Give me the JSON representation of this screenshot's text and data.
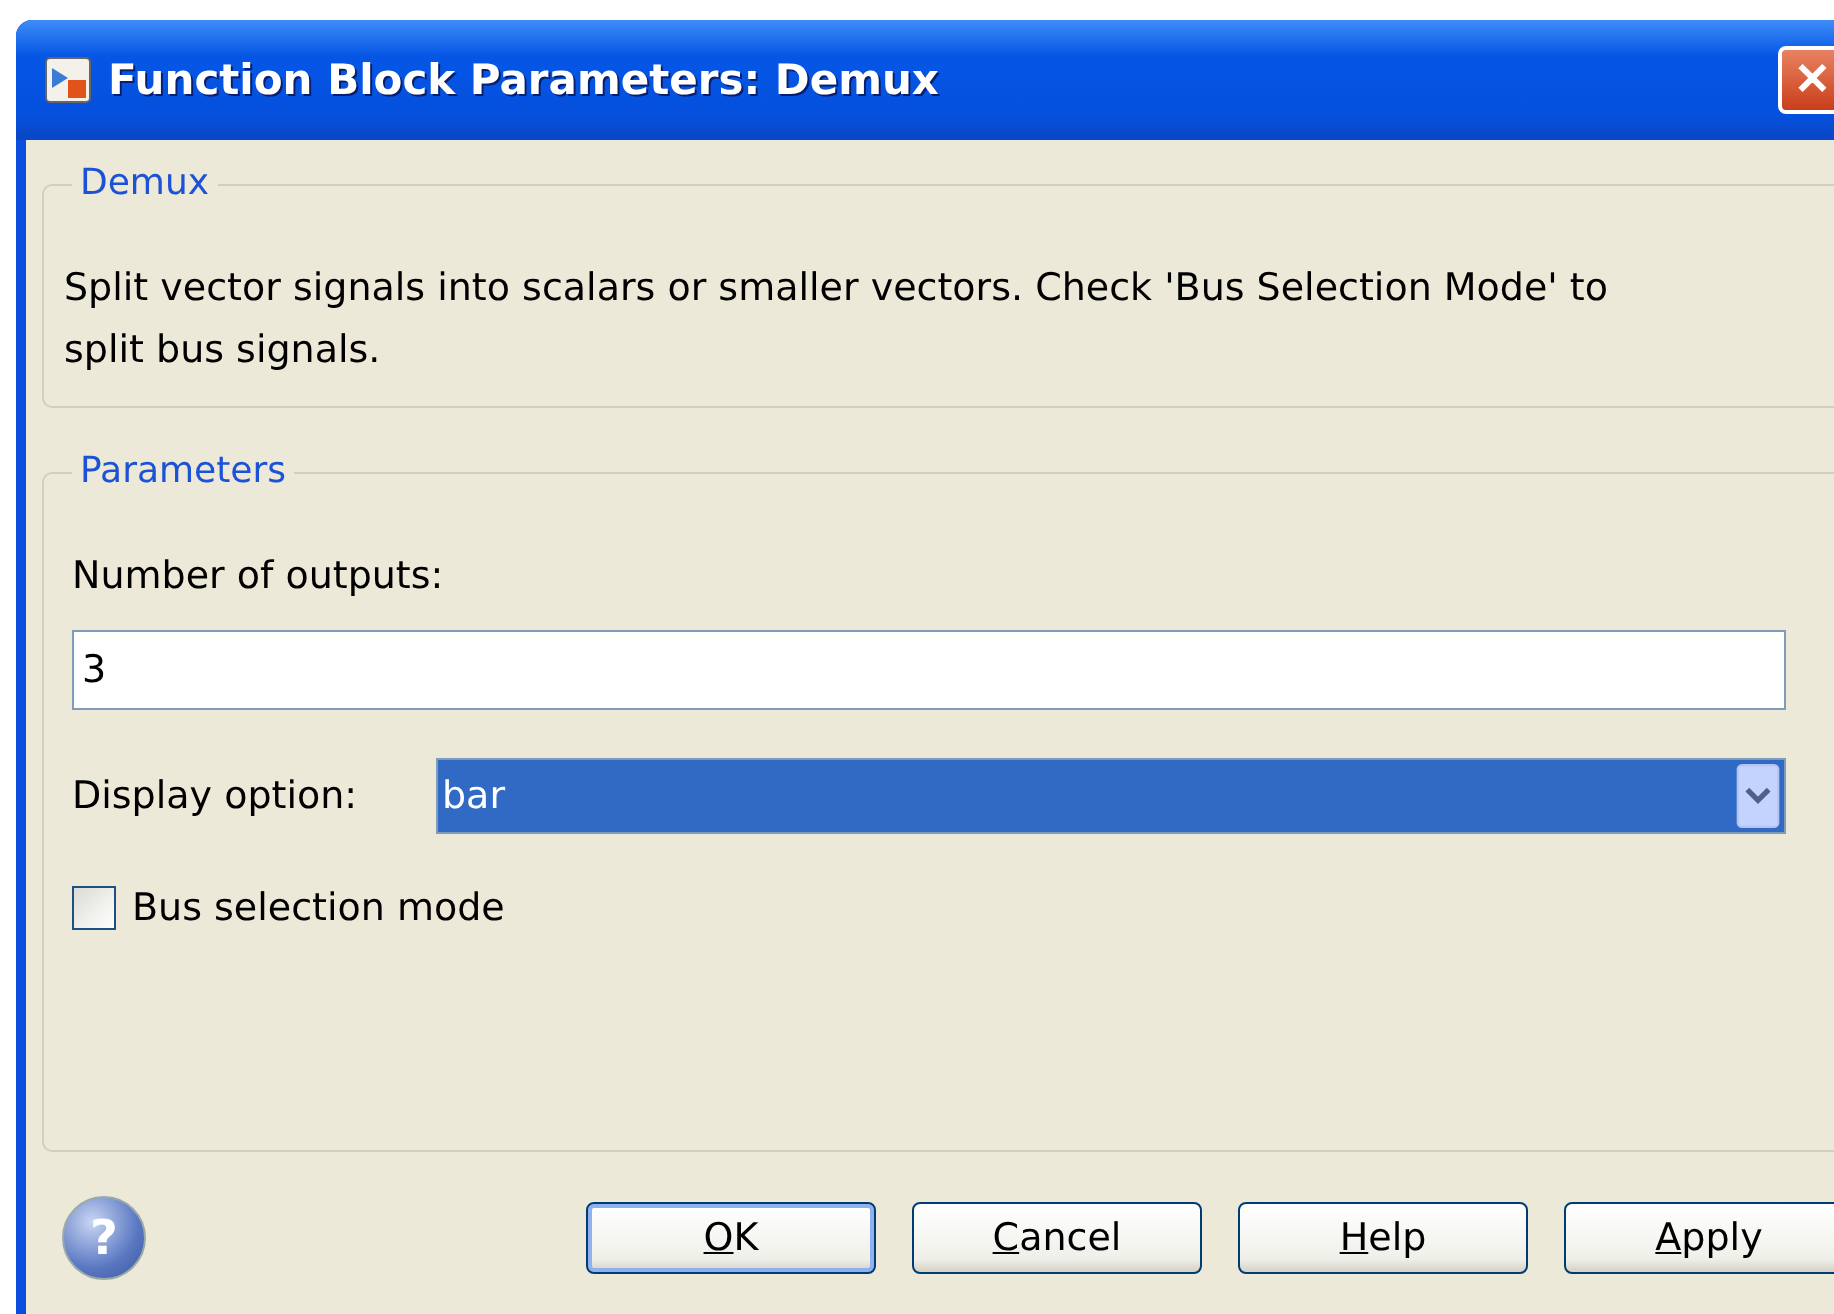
{
  "window": {
    "title": "Function Block Parameters: Demux",
    "close": "✕"
  },
  "description_group": {
    "legend": "Demux",
    "text": "Split vector signals into scalars or smaller vectors. Check 'Bus Selection Mode' to split bus signals."
  },
  "parameters_group": {
    "legend": "Parameters",
    "outputs_label": "Number of outputs:",
    "outputs_value": "3",
    "display_label": "Display option:",
    "display_value": "bar",
    "bus_mode": {
      "label": "Bus selection mode",
      "checked": false
    }
  },
  "help_icon": "?",
  "buttons": [
    {
      "access_key": "O",
      "rest": "K",
      "default": true
    },
    {
      "access_key": "C",
      "rest": "ancel",
      "default": false
    },
    {
      "access_key": "H",
      "rest": "elp",
      "default": false
    },
    {
      "access_key": "A",
      "rest": "pply",
      "default": false
    }
  ]
}
